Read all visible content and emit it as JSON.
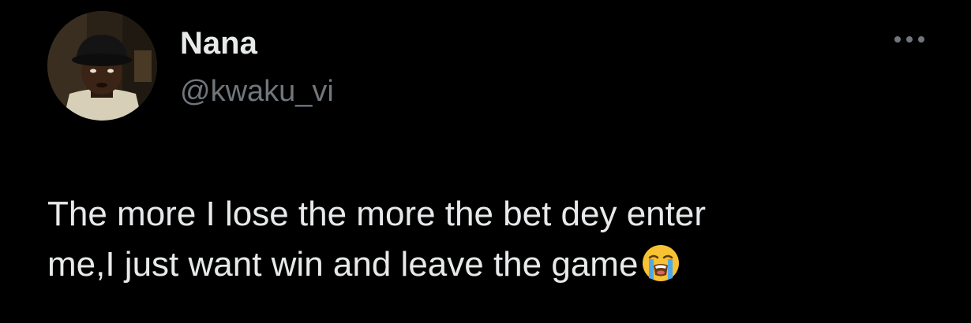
{
  "author": {
    "display_name": "Nana",
    "handle": "@kwaku_vi",
    "avatar": "profile-photo"
  },
  "more_button": {
    "icon": "ellipsis-horizontal-icon"
  },
  "tweet": {
    "line1": "The more I lose the more the bet dey enter",
    "line2": "me,I just want win and leave the game",
    "emoji": "loudly-crying-face-emoji"
  },
  "colors": {
    "background": "#000000",
    "primary_text": "#e7e9ea",
    "secondary_text": "#71767b"
  }
}
